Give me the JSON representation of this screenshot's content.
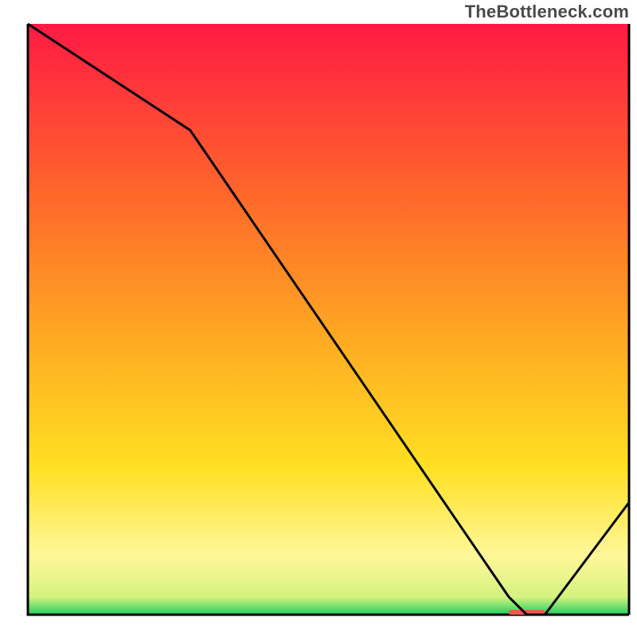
{
  "attribution": "TheBottleneck.com",
  "chart_data": {
    "type": "line",
    "title": "",
    "xlabel": "",
    "ylabel": "",
    "x": [
      0,
      27,
      80,
      83,
      86,
      100
    ],
    "values": [
      100,
      82,
      3,
      0,
      0,
      19
    ],
    "xlim": [
      0,
      100
    ],
    "ylim": [
      0,
      100
    ],
    "series_color": "#000000",
    "background_gradient": {
      "stops": [
        {
          "offset": 0,
          "color": "#ff1a44"
        },
        {
          "offset": 30,
          "color": "#ff6a2a"
        },
        {
          "offset": 55,
          "color": "#ffae22"
        },
        {
          "offset": 75,
          "color": "#ffe022"
        },
        {
          "offset": 90,
          "color": "#fff799"
        },
        {
          "offset": 97,
          "color": "#d6f280"
        },
        {
          "offset": 100,
          "color": "#1fcf5e"
        }
      ]
    },
    "marker_band": {
      "x_start": 80,
      "x_end": 86,
      "y": 0,
      "color": "#e85a4f"
    }
  }
}
